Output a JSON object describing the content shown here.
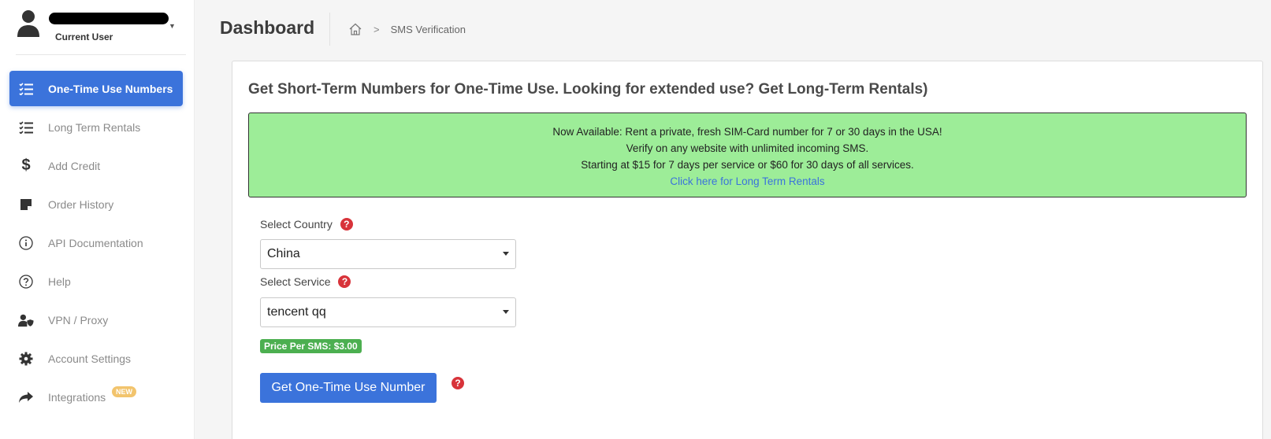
{
  "user": {
    "current_label": "Current User"
  },
  "sidebar": {
    "items": [
      {
        "label": "One-Time Use Numbers",
        "icon": "checklist-icon",
        "active": true
      },
      {
        "label": "Long Term Rentals",
        "icon": "checklist-icon"
      },
      {
        "label": "Add Credit",
        "icon": "dollar-icon"
      },
      {
        "label": "Order History",
        "icon": "note-icon"
      },
      {
        "label": "API Documentation",
        "icon": "info-icon"
      },
      {
        "label": "Help",
        "icon": "question-icon"
      },
      {
        "label": "VPN / Proxy",
        "icon": "user-shield-icon"
      },
      {
        "label": "Account Settings",
        "icon": "gear-icon"
      },
      {
        "label": "Integrations",
        "icon": "share-icon",
        "badge": "NEW"
      }
    ]
  },
  "header": {
    "title": "Dashboard",
    "breadcrumb": {
      "current": "SMS Verification"
    }
  },
  "main": {
    "title": "Get Short-Term Numbers for One-Time Use. Looking for extended use? Get Long-Term Rentals)",
    "banner": {
      "line1": "Now Available: Rent a private, fresh SIM-Card number for 7 or 30 days in the USA!",
      "line2": "Verify on any website with unlimited incoming SMS.",
      "line3": "Starting at $15 for 7 days per service or $60 for 30 days of all services.",
      "link": "Click here for Long Term Rentals"
    },
    "country": {
      "label": "Select Country",
      "value": "China"
    },
    "service": {
      "label": "Select Service",
      "value": "tencent qq"
    },
    "price_badge": "Price Per SMS: $3.00",
    "submit_label": "Get One-Time Use Number",
    "help_glyph": "?"
  },
  "colors": {
    "accent": "#3b73db",
    "banner_bg": "#9ded98",
    "help_red": "#d8333a",
    "price_green": "#4caf50"
  }
}
